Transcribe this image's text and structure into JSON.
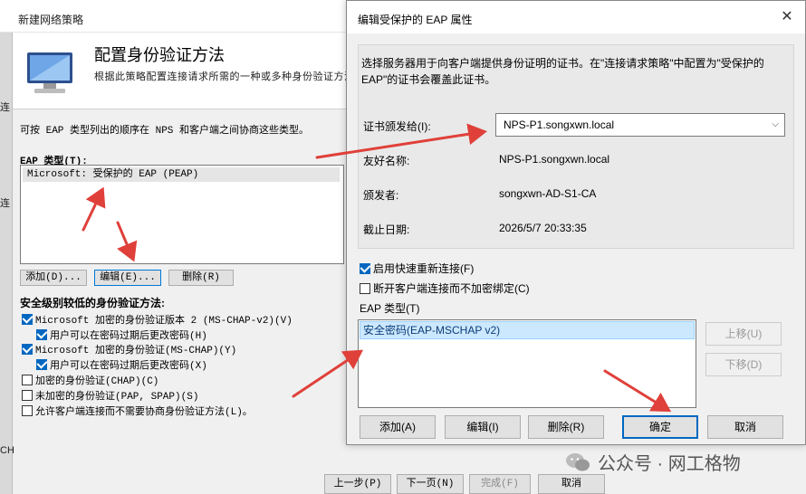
{
  "back_dialog": {
    "title": "新建网络策略",
    "header_heading": "配置身份验证方法",
    "header_sub": "根据此策略配置连接请求所需的一种或多种身份验证方法",
    "left_strip_chars": [
      "连",
      "连"
    ],
    "left_strip_bottom": "CH",
    "description": "可按 EAP 类型列出的顺序在 NPS 和客户端之间协商这些类型。",
    "eap_types_label": "EAP 类型(T):",
    "eap_types": [
      "Microsoft: 受保护的 EAP (PEAP)"
    ],
    "buttons": {
      "add": "添加(D)...",
      "edit": "编辑(E)...",
      "remove": "删除(R)"
    },
    "lower_methods_label": "安全级别较低的身份验证方法:",
    "methods": [
      {
        "label": "Microsoft 加密的身份验证版本 2 (MS-CHAP-v2)(V)",
        "checked": true,
        "sub": false
      },
      {
        "label": "用户可以在密码过期后更改密码(H)",
        "checked": true,
        "sub": true
      },
      {
        "label": "Microsoft 加密的身份验证(MS-CHAP)(Y)",
        "checked": true,
        "sub": false
      },
      {
        "label": "用户可以在密码过期后更改密码(X)",
        "checked": true,
        "sub": true
      },
      {
        "label": "加密的身份验证(CHAP)(C)",
        "checked": false,
        "sub": false
      },
      {
        "label": "未加密的身份验证(PAP, SPAP)(S)",
        "checked": false,
        "sub": false
      },
      {
        "label": "允许客户端连接而不需要协商身份验证方法(L)。",
        "checked": false,
        "sub": false
      }
    ],
    "wizard": {
      "prev": "上一步(P)",
      "next": "下一页(N)",
      "finish": "完成(F)",
      "cancel": "取消"
    }
  },
  "front_dialog": {
    "title": "编辑受保护的 EAP 属性",
    "cert_description": "选择服务器用于向客户端提供身份证明的证书。在\"连接请求策略\"中配置为\"受保护的 EAP\"的证书会覆盖此证书。",
    "cert_issued_to_label": "证书颁发给(I):",
    "cert_issued_to_value": "NPS-P1.songxwn.local",
    "friendly_name_label": "友好名称:",
    "friendly_name_value": "NPS-P1.songxwn.local",
    "issuer_label": "颁发者:",
    "issuer_value": "songxwn-AD-S1-CA",
    "expiry_label": "截止日期:",
    "expiry_value": "2026/5/7 20:33:35",
    "fast_reconnect_label": "启用快速重新连接(F)",
    "fast_reconnect_checked": true,
    "disconnect_label": "断开客户端连接而不加密绑定(C)",
    "disconnect_checked": false,
    "eap_types_label": "EAP 类型(T)",
    "eap_types": [
      "安全密码(EAP-MSCHAP v2)"
    ],
    "buttons": {
      "move_up": "上移(U)",
      "move_down": "下移(D)",
      "add": "添加(A)",
      "edit": "编辑(I)",
      "remove": "删除(R)",
      "ok": "确定",
      "cancel": "取消"
    },
    "close_glyph": "✕"
  },
  "watermark": {
    "text": "公众号 · 网工格物"
  },
  "colors": {
    "accent": "#0067c0",
    "annotation_arrow": "#e0403a",
    "selection": "#cce8ff"
  }
}
